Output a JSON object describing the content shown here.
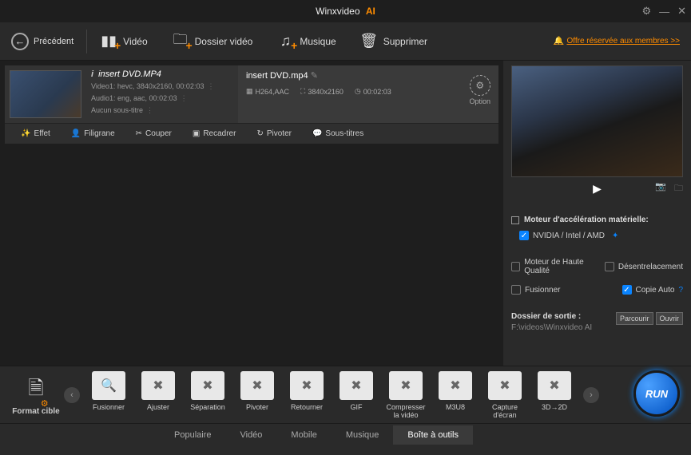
{
  "title": {
    "app": "Winxvideo",
    "suffix": "AI"
  },
  "topbar": {
    "back": "Précédent",
    "video": "Vidéo",
    "folder": "Dossier vidéo",
    "music": "Musique",
    "delete": "Supprimer",
    "offer": "Offre réservée aux membres >>"
  },
  "file": {
    "name": "insert DVD.MP4",
    "v": "Video1: hevc, 3840x2160, 00:02:03",
    "a": "Audio1: eng, aac, 00:02:03",
    "s": "Aucun sous-titre"
  },
  "output": {
    "name": "insert DVD.mp4",
    "codec": "H264,AAC",
    "res": "3840x2160",
    "dur": "00:02:03",
    "option": "Option"
  },
  "edit": {
    "effet": "Effet",
    "filigrane": "Filigrane",
    "couper": "Couper",
    "recadrer": "Recadrer",
    "pivoter": "Pivoter",
    "sous": "Sous-titres"
  },
  "opts": {
    "hw": "Moteur d'accélération matérielle:",
    "gpu": "NVIDIA / Intel / AMD",
    "hq": "Moteur de Haute Qualité",
    "deint": "Désentrelacement",
    "merge": "Fusionner",
    "auto": "Copie Auto"
  },
  "outdir": {
    "label": "Dossier de sortie :",
    "path": "F:\\videos\\Winxvideo AI",
    "browse": "Parcourir",
    "open": "Ouvrir"
  },
  "format": {
    "cible": "Format cible",
    "items": [
      "Fusionner",
      "Ajuster",
      "Séparation",
      "Pivoter",
      "Retourner",
      "GIF",
      "Compresser la vidéo",
      "M3U8",
      "Capture d'écran",
      "3D→2D"
    ]
  },
  "tabs": [
    "Populaire",
    "Vidéo",
    "Mobile",
    "Musique",
    "Boîte à outils"
  ],
  "run": "RUN"
}
